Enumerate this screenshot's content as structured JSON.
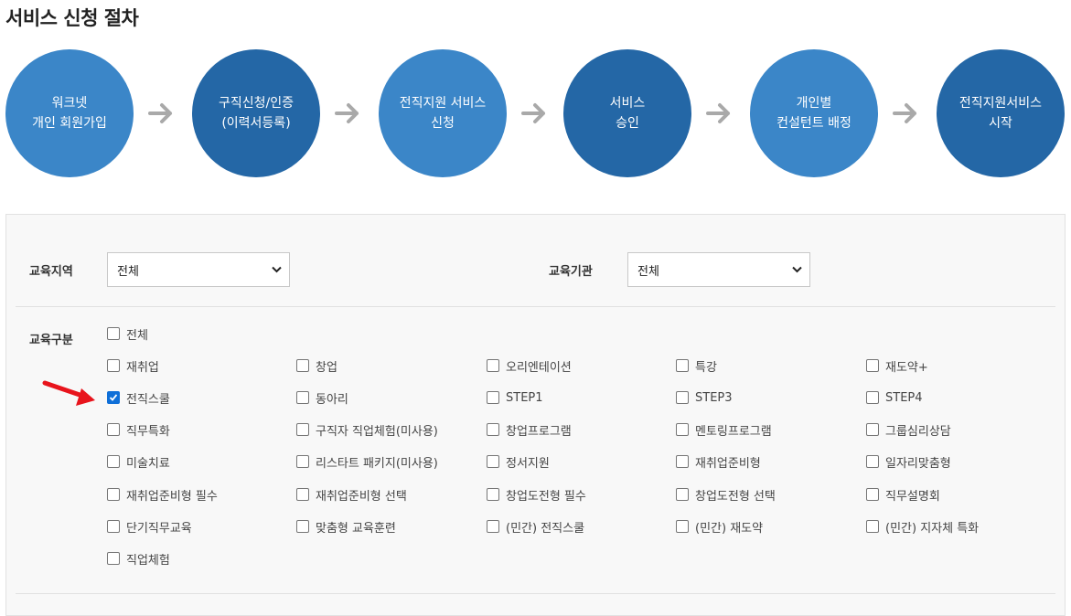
{
  "page": {
    "title": "서비스 신청 절차"
  },
  "steps": [
    {
      "label": "워크넷\n개인 회원가입",
      "color": "#3b86c8"
    },
    {
      "label": "구직신청/인증\n(이력서등록)",
      "color": "#2467a6"
    },
    {
      "label": "전직지원 서비스\n신청",
      "color": "#3b86c8"
    },
    {
      "label": "서비스\n승인",
      "color": "#2467a6"
    },
    {
      "label": "개인별\n컨설턴트 배정",
      "color": "#3b86c8"
    },
    {
      "label": "전직지원서비스\n시작",
      "color": "#2467a6"
    }
  ],
  "filters": {
    "region": {
      "label": "교육지역",
      "value": "전체"
    },
    "institution": {
      "label": "교육기관",
      "value": "전체"
    }
  },
  "category": {
    "label": "교육구분",
    "all": {
      "label": "전체",
      "checked": false
    },
    "rows": [
      [
        {
          "label": "재취업",
          "checked": false
        },
        {
          "label": "창업",
          "checked": false
        },
        {
          "label": "오리엔테이션",
          "checked": false
        },
        {
          "label": "특강",
          "checked": false
        },
        {
          "label": "재도약+",
          "checked": false
        }
      ],
      [
        {
          "label": "전직스쿨",
          "checked": true
        },
        {
          "label": "동아리",
          "checked": false
        },
        {
          "label": "STEP1",
          "checked": false
        },
        {
          "label": "STEP3",
          "checked": false
        },
        {
          "label": "STEP4",
          "checked": false
        }
      ],
      [
        {
          "label": "직무특화",
          "checked": false
        },
        {
          "label": "구직자 직업체험(미사용)",
          "checked": false
        },
        {
          "label": "창업프로그램",
          "checked": false
        },
        {
          "label": "멘토링프로그램",
          "checked": false
        },
        {
          "label": "그룹심리상담",
          "checked": false
        }
      ],
      [
        {
          "label": "미술치료",
          "checked": false
        },
        {
          "label": "리스타트 패키지(미사용)",
          "checked": false
        },
        {
          "label": "정서지원",
          "checked": false
        },
        {
          "label": "재취업준비형",
          "checked": false
        },
        {
          "label": "일자리맞춤형",
          "checked": false
        }
      ],
      [
        {
          "label": "재취업준비형 필수",
          "checked": false
        },
        {
          "label": "재취업준비형 선택",
          "checked": false
        },
        {
          "label": "창업도전형 필수",
          "checked": false
        },
        {
          "label": "창업도전형 선택",
          "checked": false
        },
        {
          "label": "직무설명회",
          "checked": false
        }
      ],
      [
        {
          "label": "단기직무교육",
          "checked": false
        },
        {
          "label": "맞춤형 교육훈련",
          "checked": false
        },
        {
          "label": "(민간) 전직스쿨",
          "checked": false
        },
        {
          "label": "(민간) 재도약",
          "checked": false
        },
        {
          "label": "(민간) 지자체 특화",
          "checked": false
        }
      ],
      [
        {
          "label": "직업체험",
          "checked": false
        }
      ]
    ]
  },
  "colors": {
    "step_light": "#3b86c8",
    "step_dark": "#2467a6",
    "arrow_gray": "#a9a9a9",
    "pointer_red": "#e8141c",
    "checkbox_blue": "#0f6fd8"
  },
  "icons": {
    "step_arrow": "arrow-right-icon",
    "pointer": "red-pointer-arrow-icon",
    "select_chevron": "chevron-down-icon",
    "check": "check-icon"
  }
}
